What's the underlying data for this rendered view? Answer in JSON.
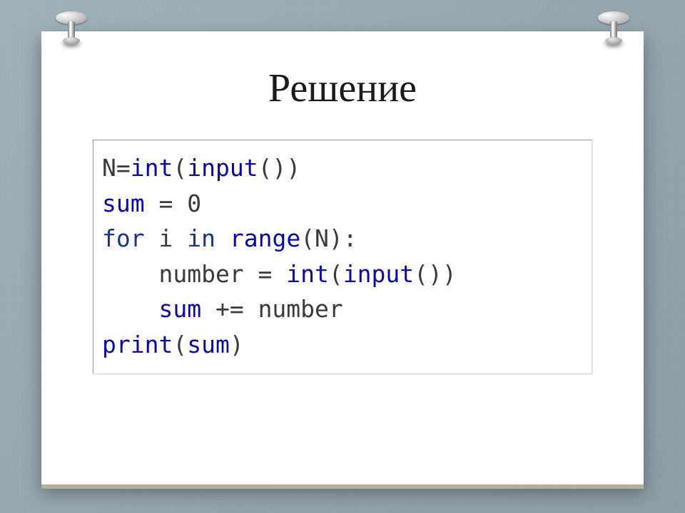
{
  "slide": {
    "title": "Решение"
  },
  "code": {
    "lines": [
      [
        {
          "text": "N",
          "cls": "c-default"
        },
        {
          "text": "=",
          "cls": "c-default"
        },
        {
          "text": "int",
          "cls": "c-builtin"
        },
        {
          "text": "(",
          "cls": "c-default"
        },
        {
          "text": "input",
          "cls": "c-builtin"
        },
        {
          "text": "())",
          "cls": "c-default"
        }
      ],
      [
        {
          "text": "sum",
          "cls": "c-builtin"
        },
        {
          "text": " = ",
          "cls": "c-default"
        },
        {
          "text": "0",
          "cls": "c-number"
        }
      ],
      [
        {
          "text": "for",
          "cls": "c-keyword"
        },
        {
          "text": " i ",
          "cls": "c-default"
        },
        {
          "text": "in",
          "cls": "c-keyword"
        },
        {
          "text": " ",
          "cls": "c-default"
        },
        {
          "text": "range",
          "cls": "c-builtin"
        },
        {
          "text": "(N):",
          "cls": "c-default"
        }
      ],
      [
        {
          "text": "    number = ",
          "cls": "c-default"
        },
        {
          "text": "int",
          "cls": "c-builtin"
        },
        {
          "text": "(",
          "cls": "c-default"
        },
        {
          "text": "input",
          "cls": "c-builtin"
        },
        {
          "text": "())",
          "cls": "c-default"
        }
      ],
      [
        {
          "text": "    ",
          "cls": "c-default"
        },
        {
          "text": "sum",
          "cls": "c-builtin"
        },
        {
          "text": " += number",
          "cls": "c-default"
        }
      ],
      [
        {
          "text": "print",
          "cls": "c-builtin"
        },
        {
          "text": "(",
          "cls": "c-default"
        },
        {
          "text": "sum",
          "cls": "c-builtin"
        },
        {
          "text": ")",
          "cls": "c-default"
        }
      ]
    ]
  }
}
